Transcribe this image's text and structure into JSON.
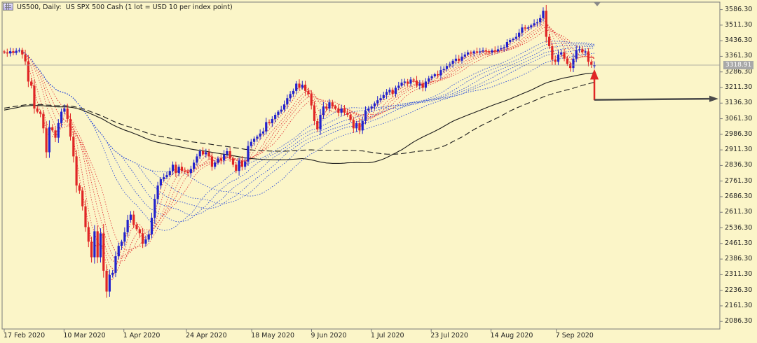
{
  "header": {
    "symbol_label": "US500, Daily:",
    "description": "US SPX 500 Cash (1 lot = USD 10 per index point)"
  },
  "icons": [
    "chart-window-icon",
    "scroll-shift-triangle-icon",
    "red-up-arrow-icon",
    "dark-right-arrow-icon"
  ],
  "current_price_label": "3318.91",
  "chart_data": {
    "type": "candlestick",
    "y_ticks": [
      "3586.30",
      "3511.30",
      "3436.30",
      "3361.30",
      "3286.30",
      "3211.30",
      "3136.30",
      "3061.30",
      "2986.30",
      "2911.30",
      "2836.30",
      "2761.30",
      "2686.30",
      "2611.30",
      "2536.30",
      "2461.30",
      "2386.30",
      "2311.30",
      "2236.30",
      "2161.30",
      "2086.30"
    ],
    "ylim": [
      2050,
      3622
    ],
    "x_labels": [
      {
        "date": "2020-02-17",
        "label": "17 Feb 2020"
      },
      {
        "date": "2020-03-10",
        "label": "10 Mar 2020"
      },
      {
        "date": "2020-04-01",
        "label": "1 Apr 2020"
      },
      {
        "date": "2020-04-24",
        "label": "24 Apr 2020"
      },
      {
        "date": "2020-05-18",
        "label": "18 May 2020"
      },
      {
        "date": "2020-06-09",
        "label": "9 Jun 2020"
      },
      {
        "date": "2020-07-01",
        "label": "1 Jul 2020"
      },
      {
        "date": "2020-07-23",
        "label": "23 Jul 2020"
      },
      {
        "date": "2020-08-14",
        "label": "14 Aug 2020"
      },
      {
        "date": "2020-09-07",
        "label": "7 Sep 2020"
      }
    ],
    "close_series": [
      3380,
      3375,
      3386,
      3378,
      3388,
      3392,
      3370,
      3337,
      3240,
      3220,
      3110,
      3095,
      3085,
      3015,
      2900,
      3020,
      3005,
      2970,
      3040,
      3095,
      3110,
      3060,
      2975,
      2880,
      2740,
      2715,
      2640,
      2540,
      2470,
      2395,
      2520,
      2395,
      2510,
      2330,
      2230,
      2310,
      2320,
      2400,
      2450,
      2470,
      2515,
      2575,
      2600,
      2550,
      2530,
      2510,
      2460,
      2480,
      2505,
      2585,
      2675,
      2740,
      2770,
      2780,
      2790,
      2810,
      2840,
      2800,
      2830,
      2810,
      2805,
      2800,
      2820,
      2850,
      2880,
      2905,
      2890,
      2900,
      2880,
      2830,
      2850,
      2870,
      2860,
      2890,
      2905,
      2870,
      2840,
      2810,
      2860,
      2830,
      2855,
      2930,
      2950,
      2965,
      2975,
      2990,
      3000,
      3045,
      3040,
      3060,
      3080,
      3095,
      3105,
      3130,
      3160,
      3180,
      3195,
      3230,
      3210,
      3225,
      3195,
      3180,
      3125,
      3050,
      3010,
      3080,
      3120,
      3110,
      3140,
      3120,
      3110,
      3090,
      3110,
      3090,
      3080,
      3055,
      3015,
      3040,
      3005,
      3050,
      3100,
      3110,
      3120,
      3135,
      3150,
      3160,
      3175,
      3190,
      3200,
      3180,
      3210,
      3220,
      3235,
      3240,
      3230,
      3250,
      3245,
      3220,
      3230,
      3210,
      3240,
      3255,
      3265,
      3275,
      3270,
      3295,
      3300,
      3315,
      3325,
      3340,
      3350,
      3340,
      3360,
      3370,
      3380,
      3375,
      3385,
      3380,
      3385,
      3390,
      3385,
      3380,
      3390,
      3385,
      3395,
      3400,
      3405,
      3430,
      3440,
      3445,
      3455,
      3475,
      3500,
      3495,
      3500,
      3510,
      3520,
      3525,
      3545,
      3580,
      3455,
      3410,
      3345,
      3335,
      3370,
      3380,
      3350,
      3325,
      3305,
      3350,
      3390,
      3395,
      3380,
      3385,
      3335,
      3320,
      3319
    ],
    "overlays": [
      {
        "type": "ma",
        "period": 3,
        "style": "dotted",
        "color": "#e23b3b"
      },
      {
        "type": "ma",
        "period": 5,
        "style": "dotted",
        "color": "#e23b3b"
      },
      {
        "type": "ma",
        "period": 8,
        "style": "dotted",
        "color": "#e23b3b"
      },
      {
        "type": "ma",
        "period": 10,
        "style": "dotted",
        "color": "#e23b3b"
      },
      {
        "type": "ma",
        "period": 12,
        "style": "dotted",
        "color": "#e23b3b"
      },
      {
        "type": "ma",
        "period": 15,
        "style": "dotted",
        "color": "#e23b3b"
      },
      {
        "type": "ma",
        "period": 30,
        "style": "dotted",
        "color": "#2f4fd8"
      },
      {
        "type": "ma",
        "period": 35,
        "style": "dotted",
        "color": "#2f4fd8"
      },
      {
        "type": "ma",
        "period": 40,
        "style": "dotted",
        "color": "#2f4fd8"
      },
      {
        "type": "ma",
        "period": 45,
        "style": "dotted",
        "color": "#2f4fd8"
      },
      {
        "type": "ma",
        "period": 50,
        "style": "dotted",
        "color": "#2f4fd8"
      },
      {
        "type": "ma",
        "period": 60,
        "style": "dotted",
        "color": "#2f4fd8"
      },
      {
        "type": "ma",
        "period": 100,
        "style": "solid",
        "color": "#1a1a1a"
      },
      {
        "type": "ma",
        "period": 120,
        "style": "dashed",
        "color": "#1a1a1a"
      }
    ],
    "colors": {
      "background": "#fbf5c8",
      "bull": "#2222cc",
      "bear": "#e02525",
      "axis": "#7a7a7a",
      "price_tag": "#a8a8a8",
      "annotation_arrow_red": "#e02525",
      "annotation_arrow_dark": "#4a4a4a"
    }
  }
}
